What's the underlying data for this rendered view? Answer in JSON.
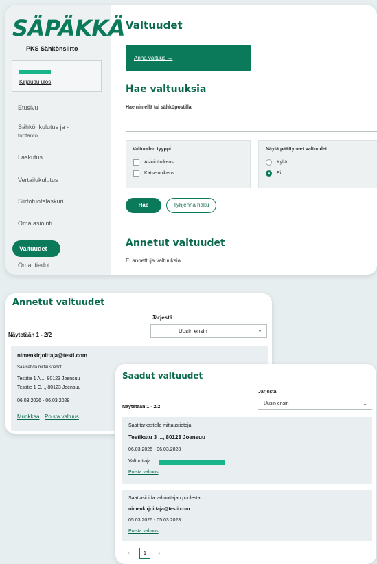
{
  "sidebar": {
    "logo": "SÄPÄKKÄ",
    "company": "PKS Sähkönsiirto",
    "logout": "Kirjaudu ulos",
    "items": [
      {
        "label": "Etusivu"
      },
      {
        "label": "Sähkönkulutus ja -"
      },
      {
        "label": "tuotanto"
      },
      {
        "label": "Laskutus"
      },
      {
        "label": "Vertailukulutus"
      },
      {
        "label": "Siirtotuotelaskuri"
      },
      {
        "label": "Oma asiointi"
      },
      {
        "label": "Valtuudet"
      },
      {
        "label": "Omat tiedot"
      }
    ]
  },
  "main": {
    "title": "Valtuudet",
    "grant_button": "Anna valtuus →",
    "search_title": "Hae valtuuksia",
    "search_label": "Hae nimellä tai sähköpostilla",
    "search_value": "",
    "type_filter": {
      "title": "Valtuuden tyyppi",
      "options": [
        "Asiointioikeus",
        "Katseluoikeus"
      ]
    },
    "ended_filter": {
      "title": "Näytä päättyneet valtuudet",
      "options": [
        "Kyllä",
        "Ei"
      ],
      "selected": "Ei"
    },
    "search_button": "Hae",
    "clear_button": "Tyhjennä haku",
    "given_title": "Annetut valtuudet",
    "given_empty": "Ei annettuja valtuuksia"
  },
  "annetut": {
    "title": "Annetut valtuudet",
    "sort_label": "Järjestä",
    "sort_value": "Uusin ensin",
    "showing": "Näytetään 1 - 2/2",
    "entry": {
      "email": "nimenkirjoittaja@testi.com",
      "permission": "Saa nähdä mittaustiedot",
      "address1": "Testitie 1 A..., 80123 Joensuu",
      "address2": "Testitie 1 C..., 80123 Joensuu",
      "dates": "06.03.2026 - 06.03.2028",
      "edit": "Muokkaa",
      "remove": "Poista valtuus"
    }
  },
  "saadut": {
    "title": "Saadut valtuudet",
    "sort_label": "Järjestä",
    "sort_value": "Uusin ensin",
    "showing": "Näytetään 1 - 2/2",
    "entries": [
      {
        "permission": "Saat tarkastella mittaustietoja",
        "address": "Testikatu 3 ..., 80123 Joensuu",
        "dates": "06.03.2026 - 06.03.2028",
        "grantor_label": "Valtuuttaja:",
        "remove": "Poista valtuus"
      },
      {
        "permission": "Saat asioida valtuuttajan puolesta",
        "email": "nimenkirjoittaja@testi.com",
        "dates": "05.03.2026 - 05.03.2028",
        "remove": "Poista valtuus"
      }
    ],
    "pagination": {
      "prev": "‹",
      "page": "1",
      "next": "›"
    }
  },
  "colors": {
    "brand": "#0b7a5a",
    "accent": "#19b58a"
  }
}
